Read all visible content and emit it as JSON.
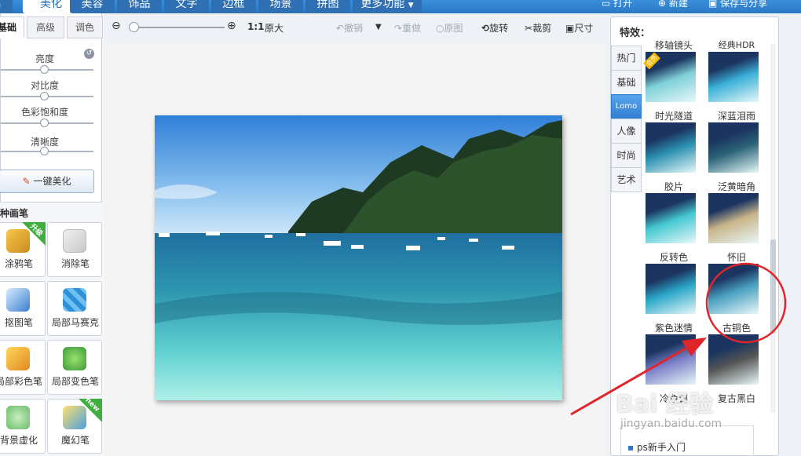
{
  "nav": {
    "tabs": [
      {
        "label": "美化"
      },
      {
        "label": "美容"
      },
      {
        "label": "饰品"
      },
      {
        "label": "文字"
      },
      {
        "label": "边框"
      },
      {
        "label": "场景"
      },
      {
        "label": "拼图"
      },
      {
        "label": "更多功能"
      }
    ],
    "open_label": "打开",
    "new_label": "新建",
    "save_label": "保存与分享"
  },
  "left": {
    "subtabs": [
      "基础",
      "高级",
      "调色"
    ],
    "sliders": [
      {
        "label": "亮度",
        "value": 0.5
      },
      {
        "label": "对比度",
        "value": 0.5
      },
      {
        "label": "色彩饱和度",
        "value": 0.5
      },
      {
        "label": "清晰度",
        "value": 0.5
      }
    ],
    "beautify_label": "一键美化",
    "brush_header": "各种画笔",
    "tools": [
      {
        "label": "涂鸦笔",
        "icon": "pencil-icon",
        "badge": "升级"
      },
      {
        "label": "消除笔",
        "icon": "eraser-icon",
        "badge": ""
      },
      {
        "label": "抠图笔",
        "icon": "cutout-icon",
        "badge": ""
      },
      {
        "label": "局部马赛克",
        "icon": "mosaic-icon",
        "badge": ""
      },
      {
        "label": "局部彩色笔",
        "icon": "color-brush-icon",
        "badge": ""
      },
      {
        "label": "局部变色笔",
        "icon": "color-change-icon",
        "badge": ""
      },
      {
        "label": "背景虚化",
        "icon": "blur-icon",
        "badge": ""
      },
      {
        "label": "魔幻笔",
        "icon": "magic-pen-icon",
        "badge": "new"
      }
    ]
  },
  "toolbar": {
    "zoom_ratio": "1:1",
    "original_size": "原大",
    "undo": "撤销",
    "redo": "重做",
    "original": "原图",
    "rotate": "旋转",
    "crop": "裁剪",
    "resize": "尺寸"
  },
  "effects": {
    "title": "特效：",
    "categories": [
      {
        "label": "热门",
        "active": false
      },
      {
        "label": "基础",
        "active": false
      },
      {
        "label": "Lomo",
        "active": true
      },
      {
        "label": "人像",
        "active": false
      },
      {
        "label": "时尚",
        "active": false
      },
      {
        "label": "艺术",
        "active": false
      }
    ],
    "items": [
      {
        "name": "移轴镜头",
        "tint": "#7fd0d8",
        "badge": "会员"
      },
      {
        "name": "经典HDR",
        "tint": "#3ab0d8",
        "badge": ""
      },
      {
        "name": "时光隧道",
        "tint": "#2a8fb0",
        "badge": ""
      },
      {
        "name": "深蓝泪雨",
        "tint": "#2a6478",
        "badge": ""
      },
      {
        "name": "胶片",
        "tint": "#45c8d2",
        "badge": ""
      },
      {
        "name": "泛黄暗角",
        "tint": "#c8b48a",
        "badge": ""
      },
      {
        "name": "反转色",
        "tint": "#2aa6c8",
        "badge": ""
      },
      {
        "name": "怀旧",
        "tint": "#4aa0c0",
        "badge": ""
      },
      {
        "name": "紫色迷情",
        "tint": "#7a80c8",
        "badge": ""
      },
      {
        "name": "古铜色",
        "tint": "#555555",
        "badge": ""
      },
      {
        "name": "冷色调",
        "tint": "#5c88c0",
        "badge": ""
      },
      {
        "name": "复古黑白",
        "tint": "#6e6e6e",
        "badge": ""
      }
    ],
    "link": "ps新手入门"
  },
  "watermark": {
    "brand": "Bai 经验",
    "url": "jingyan.baidu.com"
  },
  "colors": {
    "accent": "#2a78c6",
    "annotation": "#e0252a"
  }
}
